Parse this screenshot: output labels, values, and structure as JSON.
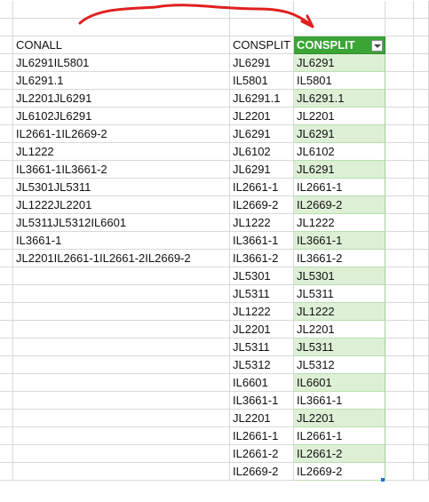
{
  "sheet": {
    "column_a": {
      "header": "CONALL",
      "values": [
        "JL6291IL5801",
        "JL6291.1",
        "JL2201JL6291",
        "JL6102JL6291",
        "IL2661-1IL2669-2",
        "JL1222",
        "IL3661-1IL3661-2",
        "JL5301JL5311",
        "JL1222JL2201",
        "JL5311JL5312IL6601",
        "IL3661-1",
        "JL2201IL2661-1IL2661-2IL2669-2"
      ]
    },
    "column_b": {
      "header": "CONSPLIT",
      "values": [
        "JL6291",
        "IL5801",
        "JL6291.1",
        "JL2201",
        "JL6291",
        "JL6102",
        "JL6291",
        "IL2661-1",
        "IL2669-2",
        "JL1222",
        "IL3661-1",
        "IL3661-2",
        "JL5301",
        "JL5311",
        "JL1222",
        "JL2201",
        "JL5311",
        "JL5312",
        "IL6601",
        "IL3661-1",
        "JL2201",
        "IL2661-1",
        "IL2661-2",
        "IL2669-2"
      ]
    },
    "column_c": {
      "header": "CONSPLIT",
      "values": [
        "JL6291",
        "IL5801",
        "JL6291.1",
        "JL2201",
        "JL6291",
        "JL6102",
        "JL6291",
        "IL2661-1",
        "IL2669-2",
        "JL1222",
        "IL3661-1",
        "IL3661-2",
        "JL5301",
        "JL5311",
        "JL1222",
        "JL2201",
        "JL5311",
        "JL5312",
        "IL6601",
        "IL3661-1",
        "JL2201",
        "IL2661-1",
        "IL2661-2",
        "IL2669-2"
      ]
    },
    "colors": {
      "table_header": "#3aa535",
      "table_band": "#ddf0d6",
      "annotation": "#e02020",
      "gridline": "#d9d9d9"
    },
    "icons": {
      "filter": "chevron-down-icon",
      "resize": "resize-handle-icon",
      "annotation": "curved-arrow-icon"
    }
  }
}
